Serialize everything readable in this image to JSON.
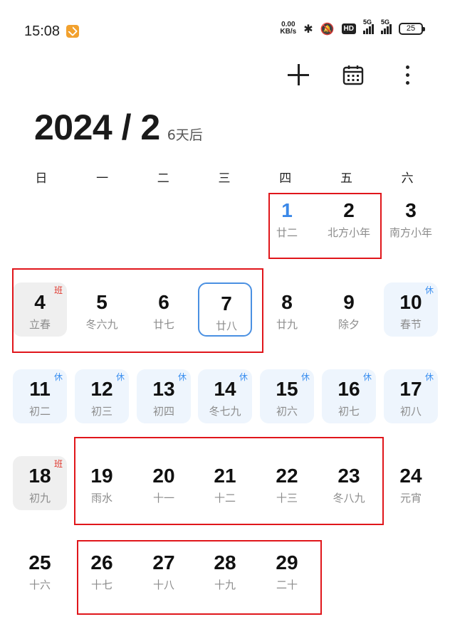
{
  "status_bar": {
    "time": "15:08",
    "net_speed_value": "0.00",
    "net_speed_unit": "KB/s",
    "hd_label": "HD",
    "sim1_label": "5G",
    "sim2_label": "5G",
    "battery": "25"
  },
  "header": {
    "title": "2024 / 2",
    "subtitle": "6天后"
  },
  "weekdays": [
    "日",
    "一",
    "二",
    "三",
    "四",
    "五",
    "六"
  ],
  "days": [
    {
      "day": "1",
      "lunar": "廿二"
    },
    {
      "day": "2",
      "lunar": "北方小年"
    },
    {
      "day": "3",
      "lunar": "南方小年"
    },
    {
      "day": "4",
      "lunar": "立春",
      "badge": "班"
    },
    {
      "day": "5",
      "lunar": "冬六九"
    },
    {
      "day": "6",
      "lunar": "廿七"
    },
    {
      "day": "7",
      "lunar": "廿八"
    },
    {
      "day": "8",
      "lunar": "廿九"
    },
    {
      "day": "9",
      "lunar": "除夕"
    },
    {
      "day": "10",
      "lunar": "春节",
      "badge": "休"
    },
    {
      "day": "11",
      "lunar": "初二",
      "badge": "休"
    },
    {
      "day": "12",
      "lunar": "初三",
      "badge": "休"
    },
    {
      "day": "13",
      "lunar": "初四",
      "badge": "休"
    },
    {
      "day": "14",
      "lunar": "冬七九",
      "badge": "休"
    },
    {
      "day": "15",
      "lunar": "初六",
      "badge": "休"
    },
    {
      "day": "16",
      "lunar": "初七",
      "badge": "休"
    },
    {
      "day": "17",
      "lunar": "初八",
      "badge": "休"
    },
    {
      "day": "18",
      "lunar": "初九",
      "badge": "班"
    },
    {
      "day": "19",
      "lunar": "雨水"
    },
    {
      "day": "20",
      "lunar": "十一"
    },
    {
      "day": "21",
      "lunar": "十二"
    },
    {
      "day": "22",
      "lunar": "十三"
    },
    {
      "day": "23",
      "lunar": "冬八九"
    },
    {
      "day": "24",
      "lunar": "元宵"
    },
    {
      "day": "25",
      "lunar": "十六"
    },
    {
      "day": "26",
      "lunar": "十七"
    },
    {
      "day": "27",
      "lunar": "十八"
    },
    {
      "day": "28",
      "lunar": "十九"
    },
    {
      "day": "29",
      "lunar": "二十"
    }
  ],
  "selected_day": "7",
  "today_day": "1",
  "colors": {
    "accent": "#3b88e8",
    "holiday_bg": "#eef5fd",
    "workday_bg": "#efefef",
    "rest_badge": "#3b8ff0",
    "work_badge": "#e0352b",
    "highlight_box": "#e0161b"
  }
}
